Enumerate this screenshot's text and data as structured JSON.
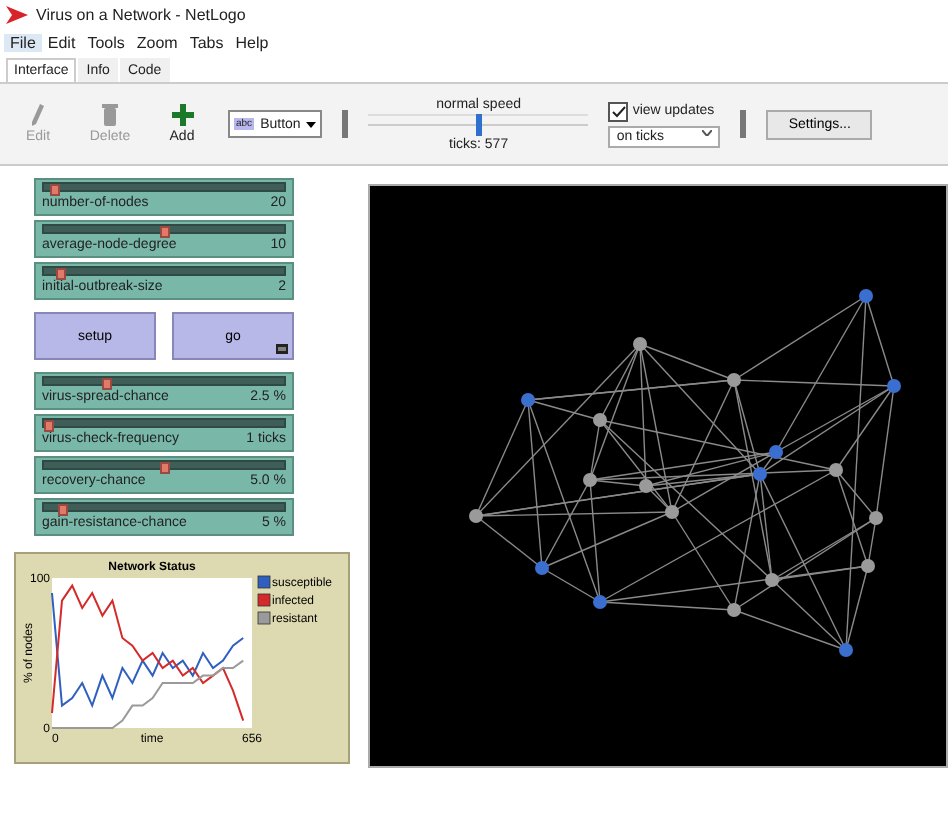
{
  "window": {
    "title": "Virus on a Network - NetLogo"
  },
  "menu": [
    {
      "label": "File",
      "selected": true
    },
    {
      "label": "Edit",
      "selected": false
    },
    {
      "label": "Tools",
      "selected": false
    },
    {
      "label": "Zoom",
      "selected": false
    },
    {
      "label": "Tabs",
      "selected": false
    },
    {
      "label": "Help",
      "selected": false
    }
  ],
  "tabs": [
    {
      "label": "Interface",
      "selected": true
    },
    {
      "label": "Info",
      "selected": false
    },
    {
      "label": "Code",
      "selected": false
    }
  ],
  "toolbar": {
    "tools": [
      {
        "label": "Edit",
        "disabled": true,
        "kind": "pencil"
      },
      {
        "label": "Delete",
        "disabled": true,
        "kind": "trash"
      },
      {
        "label": "Add",
        "disabled": false,
        "kind": "plus"
      }
    ],
    "widget_type": {
      "icon_text": "abc",
      "value": "Button"
    },
    "speed": {
      "label": "normal speed",
      "level": 0.5,
      "ticks": "ticks: 577"
    },
    "view_updates": {
      "label": "view updates",
      "checked": true,
      "mode": "on ticks"
    },
    "settings": "Settings..."
  },
  "sliders_top": [
    {
      "name": "number-of-nodes",
      "value": "20",
      "level": 0.03
    },
    {
      "name": "average-node-degree",
      "value": "10",
      "level": 0.5
    },
    {
      "name": "initial-outbreak-size",
      "value": "2",
      "level": 0.05
    }
  ],
  "buttons": [
    {
      "label": "setup",
      "forever": false
    },
    {
      "label": "go",
      "forever": true
    }
  ],
  "sliders_bottom": [
    {
      "name": "virus-spread-chance",
      "value": "2.5 %",
      "level": 0.25
    },
    {
      "name": "virus-check-frequency",
      "value": "1 ticks",
      "level": 0.0
    },
    {
      "name": "recovery-chance",
      "value": "5.0 %",
      "level": 0.5
    },
    {
      "name": "gain-resistance-chance",
      "value": "5 %",
      "level": 0.06
    }
  ],
  "plot": {
    "chart_data": {
      "type": "line",
      "title": "Network Status",
      "xlabel": "time",
      "ylabel": "% of nodes",
      "xlim": [
        0,
        656
      ],
      "ylim": [
        0,
        100
      ],
      "xticks": [
        0,
        656
      ],
      "yticks": [
        0,
        100
      ],
      "legend": true,
      "x": [
        0,
        33,
        66,
        99,
        132,
        165,
        198,
        231,
        264,
        297,
        330,
        363,
        396,
        429,
        462,
        495,
        528,
        561,
        594,
        627
      ],
      "series": [
        {
          "name": "susceptible",
          "color": "#2f5fbf",
          "values": [
            90,
            15,
            20,
            30,
            15,
            35,
            20,
            40,
            30,
            45,
            35,
            50,
            40,
            45,
            35,
            50,
            40,
            45,
            55,
            60
          ]
        },
        {
          "name": "infected",
          "color": "#d42a2a",
          "values": [
            10,
            85,
            95,
            80,
            90,
            75,
            85,
            60,
            55,
            45,
            50,
            40,
            45,
            35,
            40,
            30,
            35,
            40,
            25,
            5
          ]
        },
        {
          "name": "resistant",
          "color": "#9a9a9a",
          "values": [
            0,
            0,
            0,
            0,
            0,
            0,
            0,
            5,
            15,
            15,
            20,
            30,
            30,
            30,
            30,
            35,
            35,
            40,
            40,
            45
          ]
        }
      ]
    }
  },
  "view": {
    "nodes": [
      {
        "color": "#3a6fd0"
      },
      {
        "color": "#3a6fd0"
      },
      {
        "color": "#9a9a9a"
      },
      {
        "color": "#9a9a9a"
      },
      {
        "color": "#3a6fd0"
      },
      {
        "color": "#9a9a9a"
      },
      {
        "color": "#3a6fd0"
      },
      {
        "color": "#3a6fd0"
      },
      {
        "color": "#9a9a9a"
      },
      {
        "color": "#9a9a9a"
      },
      {
        "color": "#9a9a9a"
      },
      {
        "color": "#9a9a9a"
      },
      {
        "color": "#9a9a9a"
      },
      {
        "color": "#9a9a9a"
      },
      {
        "color": "#3a6fd0"
      },
      {
        "color": "#3a6fd0"
      },
      {
        "color": "#9a9a9a"
      },
      {
        "color": "#9a9a9a"
      },
      {
        "color": "#9a9a9a"
      },
      {
        "color": "#3a6fd0"
      }
    ]
  }
}
